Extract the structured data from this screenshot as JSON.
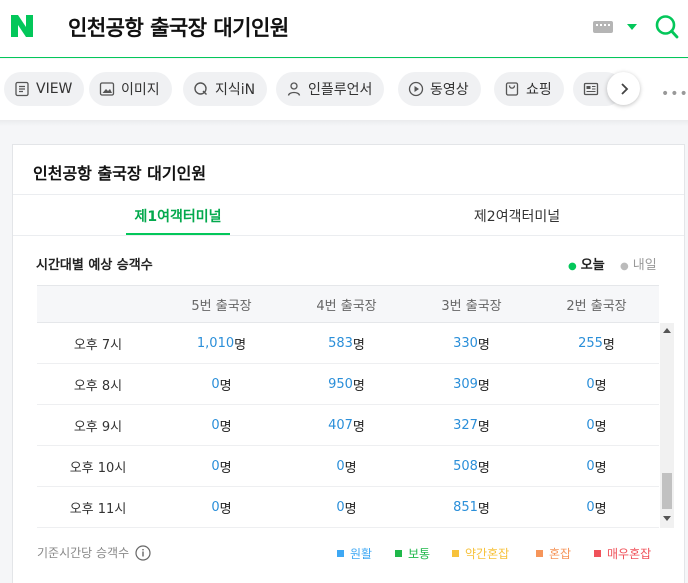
{
  "header": {
    "title": "인천공항 출국장 대기인원",
    "icons": {
      "logo": "naver-n-logo",
      "keyboard": "keyboard-icon",
      "dropdown": "caret-down-icon",
      "search": "search-icon"
    },
    "brand_color": "#03c75a"
  },
  "tabs": [
    {
      "label": "VIEW",
      "icon": "document-icon"
    },
    {
      "label": "이미지",
      "icon": "image-icon"
    },
    {
      "label": "지식iN",
      "icon": "q-icon"
    },
    {
      "label": "인플루언서",
      "icon": "person-icon"
    },
    {
      "label": "동영상",
      "icon": "play-icon"
    },
    {
      "label": "쇼핑",
      "icon": "shopping-bag-icon"
    },
    {
      "label": "",
      "icon": "news-icon"
    }
  ],
  "card": {
    "title": "인천공항 출국장 대기인원",
    "terminals": [
      {
        "label": "제1여객터미널",
        "active": true
      },
      {
        "label": "제2여객터미널",
        "active": false
      }
    ],
    "subtitle": "시간대별 예상 승객수",
    "day_toggle": {
      "today": "오늘",
      "tomorrow": "내일",
      "selected": "오늘"
    },
    "table": {
      "headers": [
        "",
        "5번 출국장",
        "4번 출국장",
        "3번 출국장",
        "2번 출국장"
      ],
      "unit": "명",
      "rows": [
        {
          "time": "오후 7시",
          "values": [
            "1,010",
            "583",
            "330",
            "255"
          ]
        },
        {
          "time": "오후 8시",
          "values": [
            "0",
            "950",
            "309",
            "0"
          ]
        },
        {
          "time": "오후 9시",
          "values": [
            "0",
            "407",
            "327",
            "0"
          ]
        },
        {
          "time": "오후 10시",
          "values": [
            "0",
            "0",
            "508",
            "0"
          ]
        },
        {
          "time": "오후 11시",
          "values": [
            "0",
            "0",
            "851",
            "0"
          ]
        }
      ]
    },
    "footer_label": "기준시간당 승객수",
    "legend": [
      {
        "label": "원활",
        "color": "#3ea8f4"
      },
      {
        "label": "보통",
        "color": "#1fb84a"
      },
      {
        "label": "약간혼잡",
        "color": "#f7c23b"
      },
      {
        "label": "혼잡",
        "color": "#f6955a"
      },
      {
        "label": "매우혼잡",
        "color": "#f0525a"
      }
    ],
    "value_color": "#2b8fd9"
  }
}
